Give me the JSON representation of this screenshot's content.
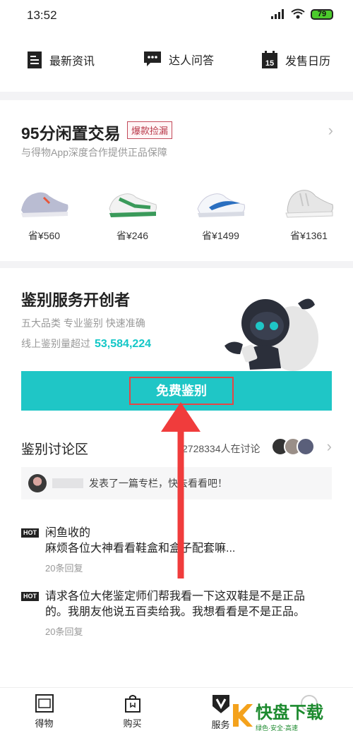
{
  "status_bar": {
    "time": "13:52",
    "battery": "79"
  },
  "top_nav": [
    {
      "label": "最新资讯",
      "icon": "document-icon"
    },
    {
      "label": "达人问答",
      "icon": "chat-icon"
    },
    {
      "label": "发售日历",
      "icon": "calendar-icon",
      "day": "15"
    }
  ],
  "card95": {
    "title": "95分闲置交易",
    "tag": "爆款捡漏",
    "subtitle": "与得物App深度合作提供正品保障",
    "products": [
      {
        "price": "省¥560",
        "color": "#b9bcd2"
      },
      {
        "price": "省¥246",
        "color": "#3a9a5a"
      },
      {
        "price": "省¥1499",
        "color": "#2a6fc0"
      },
      {
        "price": "省¥1361",
        "color": "#e6e6e6"
      }
    ]
  },
  "auth": {
    "title": "鉴别服务开创者",
    "subtitle": "五大品类 专业鉴别 快速准确",
    "count_label": "线上鉴别量超过",
    "count": "53,584,224",
    "button": "免费鉴别"
  },
  "discussion": {
    "title": "鉴别讨论区",
    "count": "2728334人在讨论",
    "notice": "发表了一篇专栏，快去看看吧！",
    "posts": [
      {
        "badge": "HOT",
        "lines": [
          "闲鱼收的",
          "麻烦各位大神看看鞋盒和盒子配套嘛..."
        ],
        "replies": "20条回复"
      },
      {
        "badge": "HOT",
        "lines": [
          "请求各位大佬鉴定师们帮我看一下这双鞋是不是正品",
          "的。我朋友他说五百卖给我。我想看看是不是正品。"
        ],
        "replies": "20条回复"
      }
    ]
  },
  "tabs": [
    {
      "label": "得物",
      "icon": "dewu-icon"
    },
    {
      "label": "购买",
      "icon": "shopping-bag-icon"
    },
    {
      "label": "服务",
      "icon": "shield-v-icon"
    },
    {
      "label": "",
      "icon": "profile-icon"
    }
  ],
  "watermark": {
    "main": "快盘下载",
    "sub": "绿色·安全·高速"
  },
  "colors": {
    "accent": "#1fc6c6",
    "highlight": "#e64545",
    "tag": "#b8394a"
  }
}
